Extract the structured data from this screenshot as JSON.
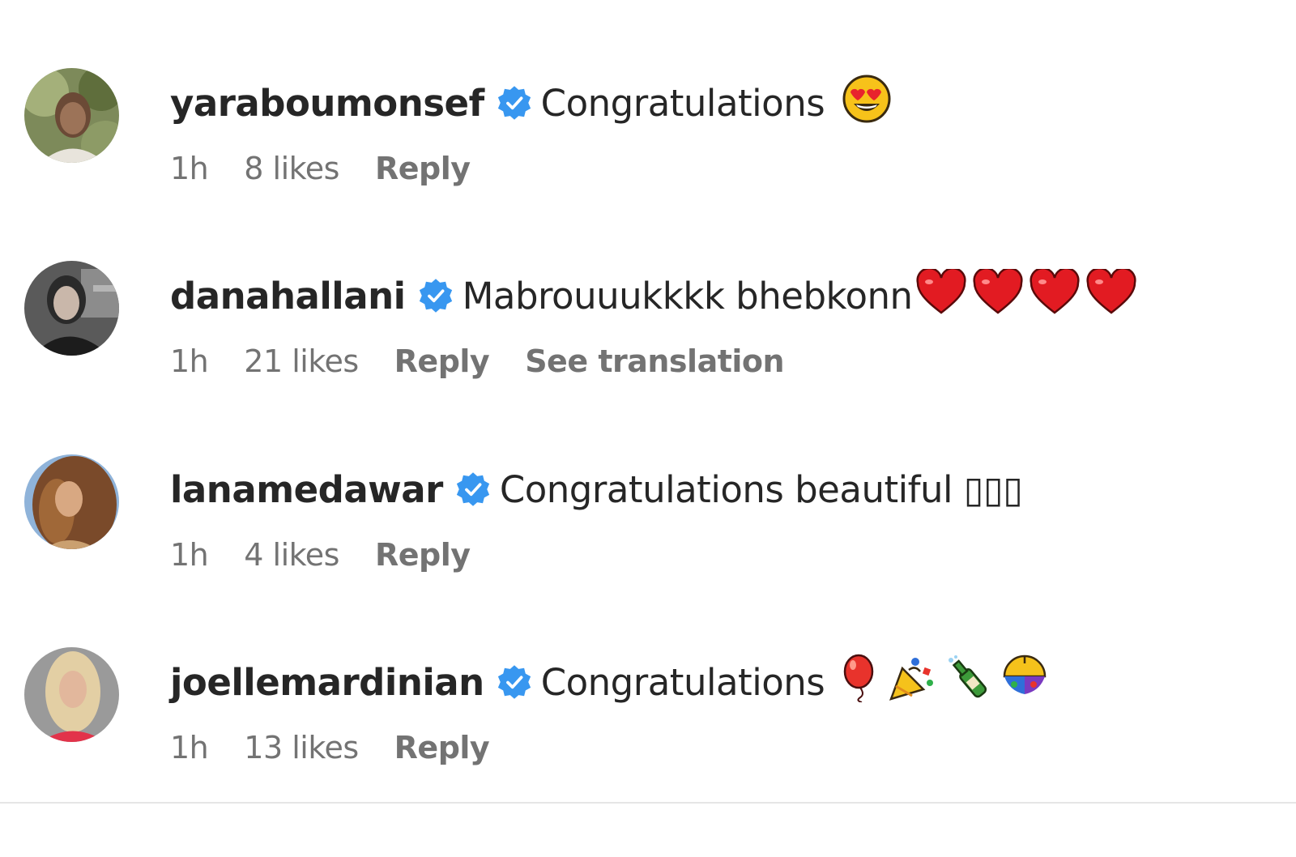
{
  "comments": [
    {
      "username": "yaraboumonsef",
      "text": "Congratulations",
      "emoji_names": [
        "heart-eyes-emoji"
      ],
      "time": "1h",
      "likes": "8 likes",
      "reply": "Reply",
      "translation": null
    },
    {
      "username": "danahallani",
      "text": "Mabrouuukkkk bhebkonn",
      "emoji_names": [
        "red-heart-emoji",
        "red-heart-emoji",
        "red-heart-emoji",
        "red-heart-emoji"
      ],
      "time": "1h",
      "likes": "21 likes",
      "reply": "Reply",
      "translation": "See translation"
    },
    {
      "username": "lanamedawar",
      "text": "Congratulations beautiful ▯▯▯",
      "emoji_names": [],
      "time": "1h",
      "likes": "4 likes",
      "reply": "Reply",
      "translation": null
    },
    {
      "username": "joellemardinian",
      "text": "Congratulations",
      "emoji_names": [
        "balloon-emoji",
        "party-popper-emoji",
        "champagne-emoji",
        "confetti-ball-emoji"
      ],
      "time": "1h",
      "likes": "13 likes",
      "reply": "Reply",
      "translation": null
    }
  ],
  "colors": {
    "verified_badge": "#3897f0",
    "meta_text": "#737373",
    "primary_text": "#262626",
    "divider": "#e6e6e6"
  }
}
